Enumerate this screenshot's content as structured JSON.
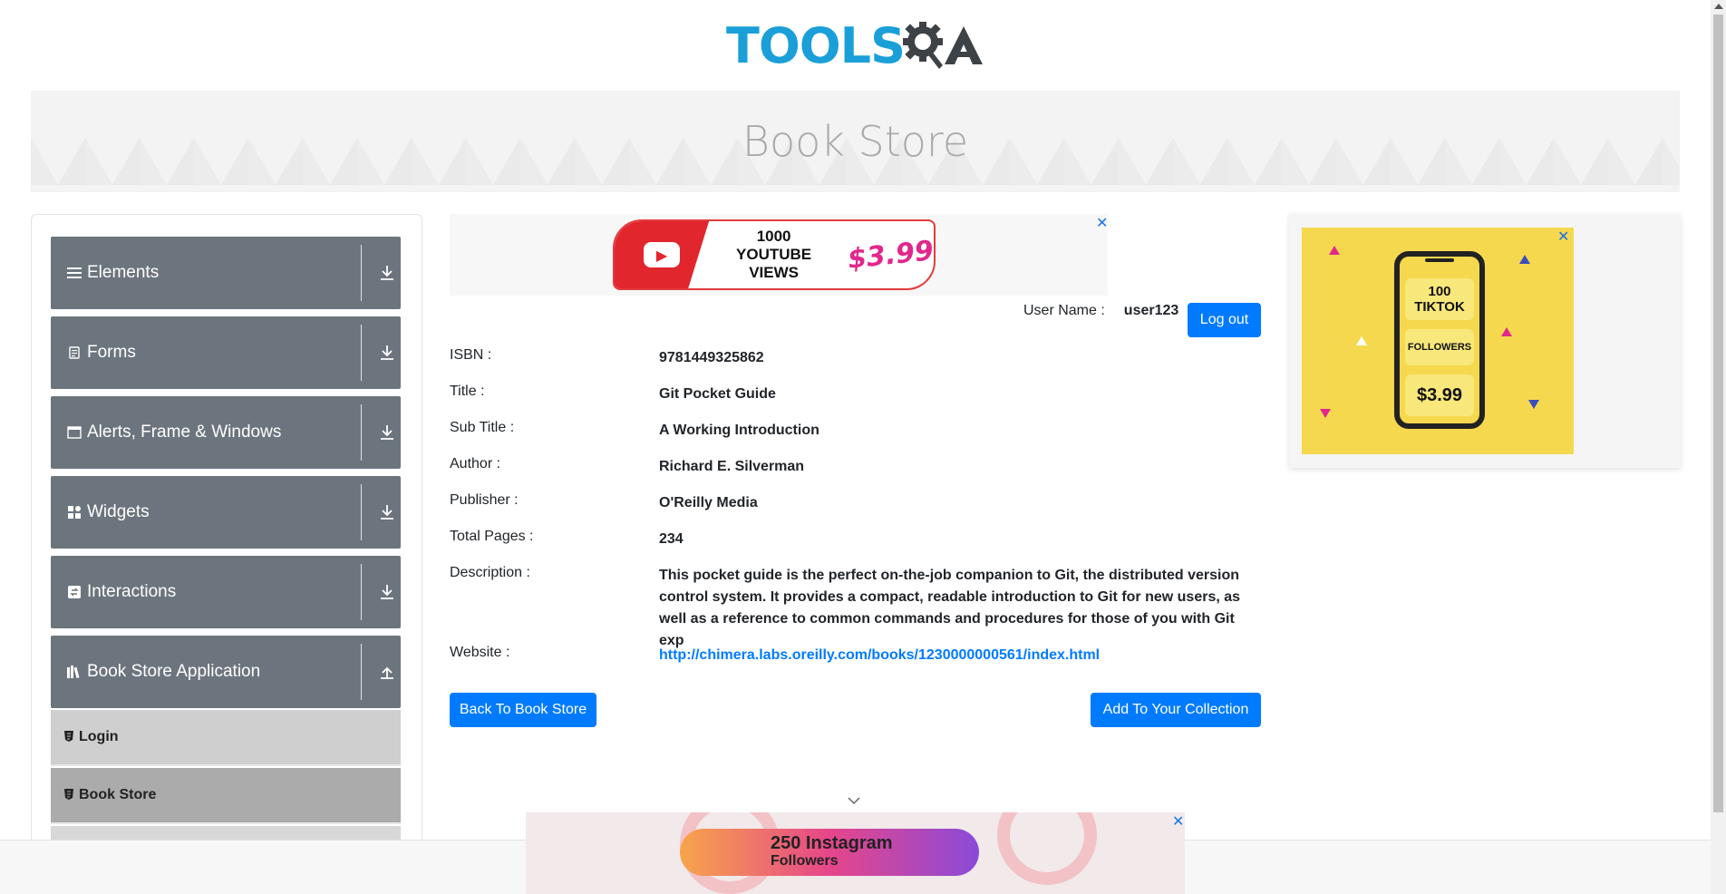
{
  "header": {
    "logo_part1": "TOOLS",
    "logo_part2": "QA",
    "page_title": "Book Store"
  },
  "sidebar": {
    "groups": [
      {
        "label": "Elements",
        "icon": "list-icon"
      },
      {
        "label": "Forms",
        "icon": "document-icon"
      },
      {
        "label": "Alerts, Frame & Windows",
        "icon": "window-icon"
      },
      {
        "label": "Widgets",
        "icon": "grid-icon"
      },
      {
        "label": "Interactions",
        "icon": "interaction-icon"
      },
      {
        "label": "Book Store Application",
        "icon": "books-icon"
      }
    ],
    "sub_items": [
      {
        "label": "Login"
      },
      {
        "label": "Book Store"
      }
    ]
  },
  "ads": {
    "top": {
      "line1": "1000",
      "line2": "YOUTUBE VIEWS",
      "price": "$3.99"
    },
    "right": {
      "line1": "100",
      "line2": "TIKTOK",
      "line3": "FOLLOWERS",
      "price": "$3.99"
    },
    "bottom": {
      "line1": "250 Instagram",
      "line2": "Followers"
    },
    "close_glyph": "✕"
  },
  "user": {
    "label": "User Name :",
    "value": "user123",
    "logout_label": "Log out"
  },
  "book": {
    "isbn_label": "ISBN :",
    "isbn": "9781449325862",
    "title_label": "Title :",
    "title": "Git Pocket Guide",
    "subtitle_label": "Sub Title :",
    "subtitle": "A Working Introduction",
    "author_label": "Author :",
    "author": "Richard E. Silverman",
    "publisher_label": "Publisher :",
    "publisher": "O'Reilly Media",
    "pages_label": "Total Pages :",
    "pages": "234",
    "description_label": "Description :",
    "description": "This pocket guide is the perfect on-the-job companion to Git, the distributed version control system. It provides a compact, readable introduction to Git for new users, as well as a reference to common commands and procedures for those of you with Git exp",
    "website_label": "Website :",
    "website": "http://chimera.labs.oreilly.com/books/1230000000561/index.html"
  },
  "actions": {
    "back_label": "Back To Book Store",
    "add_label": "Add To Your Collection"
  },
  "colors": {
    "primary": "#007bff",
    "sidebar_group": "#6c757d",
    "logo_blue": "#1a9fd8"
  }
}
